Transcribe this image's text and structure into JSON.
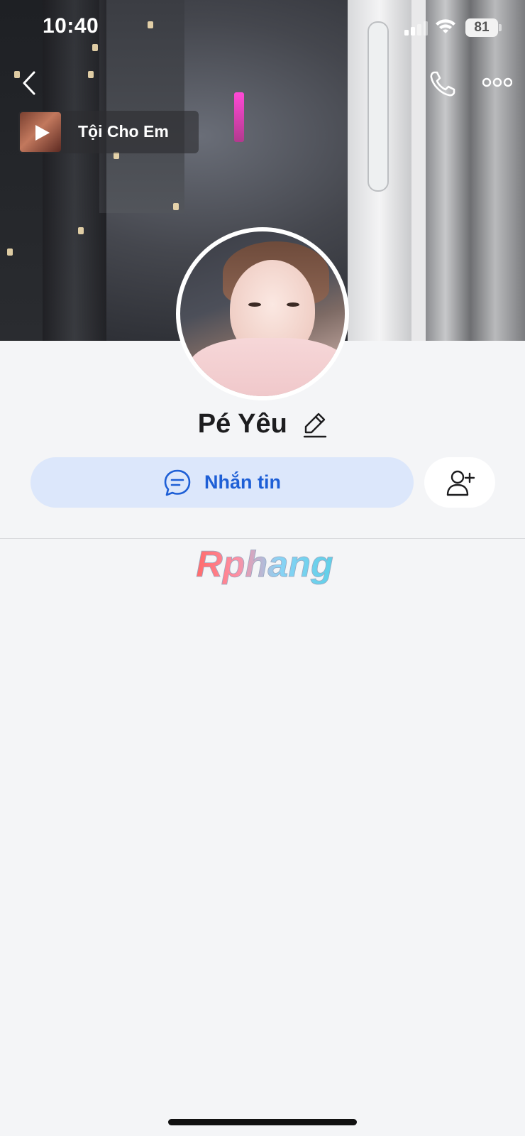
{
  "status_bar": {
    "time": "10:40",
    "battery_level": "81",
    "signal_bars_on": 2,
    "signal_bars_total": 4,
    "icons": [
      "cellular-signal-icon",
      "wifi-icon",
      "battery-icon"
    ]
  },
  "nav": {
    "back_icon": "chevron-left-icon",
    "call_icon": "phone-icon",
    "more_icon": "more-dots-icon"
  },
  "music": {
    "title": "Tội Cho Em",
    "icon": "play-icon"
  },
  "profile": {
    "name": "Pé Yêu",
    "edit_icon": "pencil-icon"
  },
  "actions": {
    "message_label": "Nhắn tin",
    "message_icon": "chat-bubble-icon",
    "add_friend_icon": "add-friend-icon"
  },
  "watermark": {
    "text": "Rphang"
  },
  "colors": {
    "accent": "#1e5fd6",
    "message_button_bg": "#dce7fb",
    "page_bg": "#f4f5f7"
  }
}
